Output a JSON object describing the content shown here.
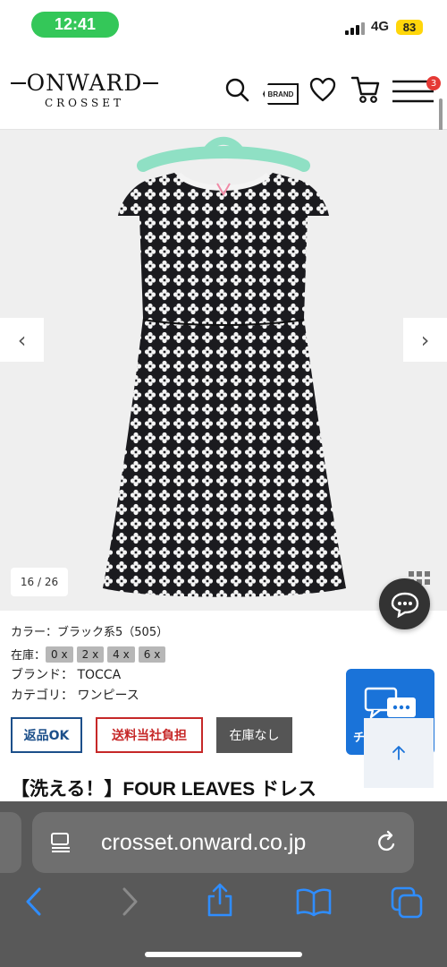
{
  "status_bar": {
    "time": "12:41",
    "network": "4G",
    "battery": "83"
  },
  "header": {
    "logo_main": "ONWARD",
    "logo_sub": "CROSSET",
    "brand_icon_label": "BRAND",
    "menu_badge_count": "3",
    "icons": [
      "search-icon",
      "brand-tag-icon",
      "heart-icon",
      "cart-icon",
      "menu-icon"
    ]
  },
  "gallery": {
    "counter": "16 / 26",
    "prev_icon": "chevron-left-icon",
    "next_icon": "chevron-right-icon"
  },
  "product": {
    "color": "カラー：ブラック系5（505）",
    "stock_label": "在庫：",
    "sizes": [
      {
        "size": "0",
        "mark": "x"
      },
      {
        "size": "2",
        "mark": "x"
      },
      {
        "size": "4",
        "mark": "x"
      },
      {
        "size": "6",
        "mark": "x"
      }
    ],
    "brand_label": "ブランド：",
    "brand": "TOCCA",
    "category_label": "カテゴリ：",
    "category": "ワンピース",
    "title": "【洗える！】FOUR LEAVES ドレス"
  },
  "tags": {
    "returnable": "返品OK",
    "free_shipping": "送料当社負担",
    "out_of_stock": "在庫なし"
  },
  "chat": {
    "label": "チ"
  },
  "browser": {
    "url": "crosset.onward.co.jp",
    "toolbar_icons": [
      "back-icon",
      "forward-icon",
      "share-icon",
      "bookmarks-icon",
      "tabs-icon"
    ]
  },
  "colors": {
    "time_pill": "#34c759",
    "battery": "#ffd60a",
    "returnable_tag": "#1c4f8a",
    "shipping_tag": "#c62828",
    "stock_tag": "#555555",
    "chat_blue": "#1a73d9",
    "safari_bg": "#595959",
    "toolbar_blue": "#2f8dff"
  }
}
